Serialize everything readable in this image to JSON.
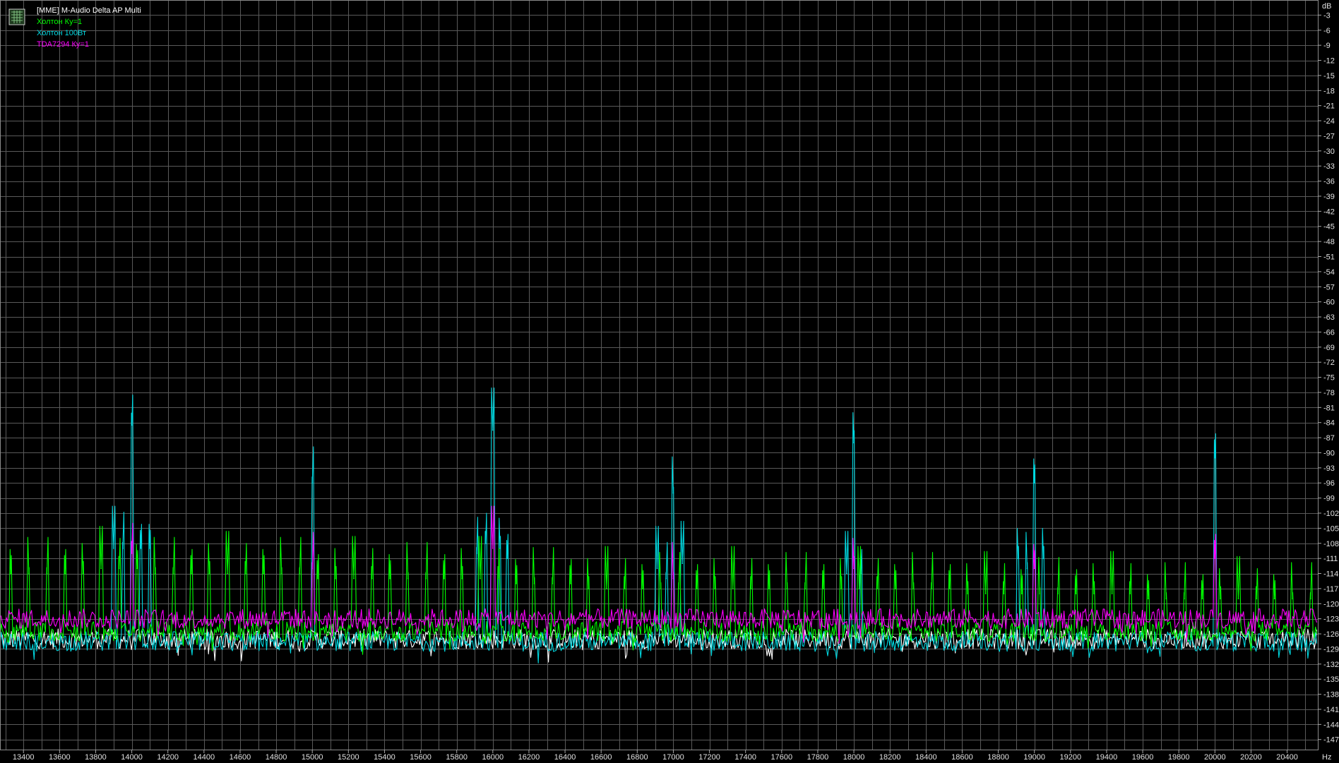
{
  "app": {
    "device_title": "[MME] M-Audio Delta AP Multi",
    "icon": "spectrum-analyzer-app-icon"
  },
  "chart_data": {
    "type": "line",
    "title": "",
    "xlabel": "Hz",
    "ylabel": "dB",
    "xlim": [
      13270,
      20570
    ],
    "ylim": [
      -149,
      0
    ],
    "grid": true,
    "background": "#000000",
    "grid_color": "#5a5a5a",
    "x_ticks": [
      13400,
      13600,
      13800,
      14000,
      14200,
      14400,
      14600,
      14800,
      15000,
      15200,
      15400,
      15600,
      15800,
      16000,
      16200,
      16400,
      16600,
      16800,
      17000,
      17200,
      17400,
      17600,
      17800,
      18000,
      18200,
      18400,
      18600,
      18800,
      19000,
      19200,
      19400,
      19600,
      19800,
      20000,
      20200,
      20400
    ],
    "y_ticks": [
      -3,
      -6,
      -9,
      -12,
      -15,
      -18,
      -21,
      -24,
      -27,
      -30,
      -33,
      -36,
      -39,
      -42,
      -45,
      -48,
      -51,
      -54,
      -57,
      -60,
      -63,
      -66,
      -69,
      -72,
      -75,
      -78,
      -81,
      -84,
      -87,
      -90,
      -93,
      -96,
      -99,
      -102,
      -105,
      -108,
      -111,
      -114,
      -117,
      -120,
      -123,
      -126,
      -129,
      -132,
      -135,
      -138,
      -141,
      -144,
      -147
    ],
    "series": [
      {
        "color": "#ffffff",
        "noise_floor": -127,
        "peaks": []
      },
      {
        "name": "Холтон Ку=1",
        "color": "#00ff00",
        "noise_floor": -125.5,
        "peaks": [
          {
            "x": 13330,
            "y": -114
          },
          {
            "x": 13430,
            "y": -114
          },
          {
            "x": 13530,
            "y": -114
          },
          {
            "x": 13630,
            "y": -114
          },
          {
            "x": 13730,
            "y": -114
          },
          {
            "x": 13830,
            "y": -113
          },
          {
            "x": 13930,
            "y": -113
          },
          {
            "x": 14030,
            "y": -113
          },
          {
            "x": 14130,
            "y": -114
          },
          {
            "x": 14230,
            "y": -114
          },
          {
            "x": 14330,
            "y": -114
          },
          {
            "x": 14430,
            "y": -114
          },
          {
            "x": 14530,
            "y": -114
          },
          {
            "x": 14630,
            "y": -114
          },
          {
            "x": 14730,
            "y": -114
          },
          {
            "x": 14830,
            "y": -114
          },
          {
            "x": 14930,
            "y": -114
          },
          {
            "x": 15030,
            "y": -115
          },
          {
            "x": 15130,
            "y": -115
          },
          {
            "x": 15230,
            "y": -115
          },
          {
            "x": 15330,
            "y": -115
          },
          {
            "x": 15430,
            "y": -115
          },
          {
            "x": 15530,
            "y": -115
          },
          {
            "x": 15630,
            "y": -115
          },
          {
            "x": 15730,
            "y": -115
          },
          {
            "x": 15830,
            "y": -115
          },
          {
            "x": 15930,
            "y": -115
          },
          {
            "x": 16030,
            "y": -115
          },
          {
            "x": 16130,
            "y": -116
          },
          {
            "x": 16230,
            "y": -116
          },
          {
            "x": 16330,
            "y": -116
          },
          {
            "x": 16430,
            "y": -116
          },
          {
            "x": 16530,
            "y": -117
          },
          {
            "x": 16630,
            "y": -117
          },
          {
            "x": 16730,
            "y": -117
          },
          {
            "x": 16830,
            "y": -117
          },
          {
            "x": 16930,
            "y": -117
          },
          {
            "x": 17030,
            "y": -117
          },
          {
            "x": 17130,
            "y": -117
          },
          {
            "x": 17230,
            "y": -117
          },
          {
            "x": 17330,
            "y": -117
          },
          {
            "x": 17430,
            "y": -117
          },
          {
            "x": 17530,
            "y": -117
          },
          {
            "x": 17630,
            "y": -117
          },
          {
            "x": 17730,
            "y": -117
          },
          {
            "x": 17830,
            "y": -117
          },
          {
            "x": 17930,
            "y": -117
          },
          {
            "x": 18030,
            "y": -117
          },
          {
            "x": 18130,
            "y": -117
          },
          {
            "x": 18230,
            "y": -117
          },
          {
            "x": 18330,
            "y": -117
          },
          {
            "x": 18430,
            "y": -117
          },
          {
            "x": 18530,
            "y": -117
          },
          {
            "x": 18630,
            "y": -118
          },
          {
            "x": 18730,
            "y": -118
          },
          {
            "x": 18830,
            "y": -118
          },
          {
            "x": 18930,
            "y": -118
          },
          {
            "x": 19030,
            "y": -118
          },
          {
            "x": 19130,
            "y": -118
          },
          {
            "x": 19230,
            "y": -118
          },
          {
            "x": 19330,
            "y": -118
          },
          {
            "x": 19430,
            "y": -118
          },
          {
            "x": 19530,
            "y": -118
          },
          {
            "x": 19630,
            "y": -119
          },
          {
            "x": 19730,
            "y": -119
          },
          {
            "x": 19830,
            "y": -119
          },
          {
            "x": 19930,
            "y": -119
          },
          {
            "x": 20030,
            "y": -119
          },
          {
            "x": 20130,
            "y": -119
          },
          {
            "x": 20230,
            "y": -119
          },
          {
            "x": 20330,
            "y": -119
          },
          {
            "x": 20430,
            "y": -119
          },
          {
            "x": 20530,
            "y": -119
          }
        ]
      },
      {
        "name": "Холтон 100Вт",
        "color": "#00d8e0",
        "noise_floor": -127.5,
        "peaks": [
          {
            "x": 13900,
            "y": -109
          },
          {
            "x": 13950,
            "y": -109
          },
          {
            "x": 14000,
            "y": -84.5
          },
          {
            "x": 14050,
            "y": -109
          },
          {
            "x": 14100,
            "y": -109
          },
          {
            "x": 15000,
            "y": -96
          },
          {
            "x": 15910,
            "y": -110
          },
          {
            "x": 15960,
            "y": -108
          },
          {
            "x": 16000,
            "y": -85.5
          },
          {
            "x": 16040,
            "y": -109
          },
          {
            "x": 16080,
            "y": -111
          },
          {
            "x": 16910,
            "y": -113
          },
          {
            "x": 16960,
            "y": -115
          },
          {
            "x": 17000,
            "y": -98
          },
          {
            "x": 17050,
            "y": -112
          },
          {
            "x": 17960,
            "y": -114
          },
          {
            "x": 18000,
            "y": -88
          },
          {
            "x": 18040,
            "y": -114
          },
          {
            "x": 18910,
            "y": -111
          },
          {
            "x": 18960,
            "y": -113
          },
          {
            "x": 19000,
            "y": -96
          },
          {
            "x": 19050,
            "y": -111
          },
          {
            "x": 20000,
            "y": -91
          }
        ]
      },
      {
        "name": "TDA7294 Ку=1",
        "color": "#ff00ff",
        "noise_floor": -123,
        "peaks": [
          {
            "x": 14000,
            "y": -110
          },
          {
            "x": 15000,
            "y": -113
          },
          {
            "x": 16000,
            "y": -109
          },
          {
            "x": 17000,
            "y": -115
          },
          {
            "x": 18000,
            "y": -113
          },
          {
            "x": 19000,
            "y": -113
          },
          {
            "x": 20000,
            "y": -111
          }
        ]
      }
    ]
  }
}
